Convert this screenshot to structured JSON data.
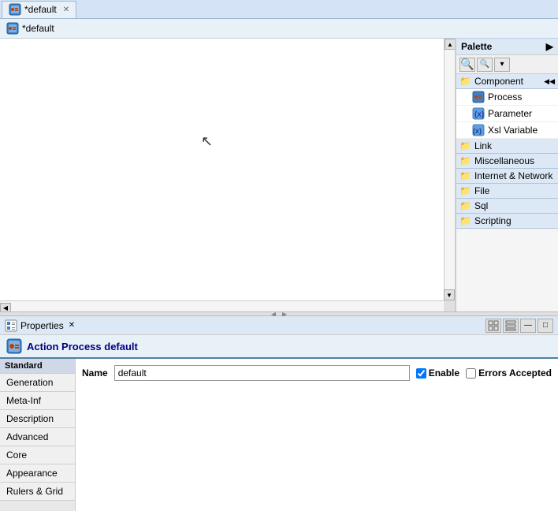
{
  "tab": {
    "label": "*default",
    "icon": "process-icon"
  },
  "breadcrumb": {
    "label": "*default"
  },
  "palette": {
    "title": "Palette",
    "sections": [
      {
        "label": "Component",
        "expanded": true,
        "items": [
          {
            "label": "Process",
            "icon": "process"
          },
          {
            "label": "Parameter",
            "icon": "parameter"
          },
          {
            "label": "Xsl Variable",
            "icon": "xsl-variable"
          }
        ]
      },
      {
        "label": "Link",
        "expanded": false,
        "items": []
      },
      {
        "label": "Miscellaneous",
        "expanded": false,
        "items": []
      },
      {
        "label": "Internet & Network",
        "expanded": false,
        "items": []
      },
      {
        "label": "File",
        "expanded": false,
        "items": []
      },
      {
        "label": "Sql",
        "expanded": false,
        "items": []
      },
      {
        "label": "Scripting",
        "expanded": false,
        "items": []
      }
    ]
  },
  "properties": {
    "panel_title": "Properties",
    "action_title": "Action Process default",
    "name_label": "Name",
    "name_value": "default",
    "enable_label": "Enable",
    "enable_checked": true,
    "errors_accepted_label": "Errors Accepted",
    "errors_accepted_checked": false,
    "sidebar_header": "Standard",
    "sidebar_items": [
      {
        "label": "Generation",
        "active": false
      },
      {
        "label": "Meta-Inf",
        "active": false
      },
      {
        "label": "Description",
        "active": false
      },
      {
        "label": "Advanced",
        "active": false
      },
      {
        "label": "Core",
        "active": false
      },
      {
        "label": "Appearance",
        "active": false
      },
      {
        "label": "Rulers & Grid",
        "active": false
      }
    ]
  },
  "toolbar": {
    "zoom_in": "+",
    "zoom_out": "-",
    "dropdown": "▾",
    "collapse": "◀"
  }
}
